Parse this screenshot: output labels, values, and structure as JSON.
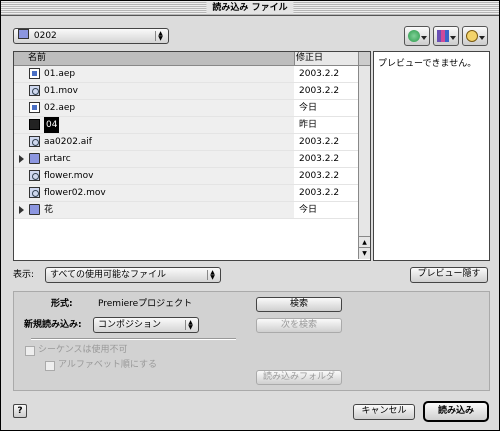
{
  "window": {
    "title": "読み込み ファイル"
  },
  "location": {
    "folder": "0202",
    "folder_icon": "folder-icon"
  },
  "toolbar": [
    {
      "name": "disk-icon",
      "color": "#2b9a4a"
    },
    {
      "name": "favorites-icon",
      "color": "#6a4fb5"
    },
    {
      "name": "recent-clock-icon",
      "color": "#c89b1e"
    }
  ],
  "list": {
    "headers": {
      "name": "名前",
      "modified": "修正日"
    },
    "rows": [
      {
        "name": "01.aep",
        "date": "2003.2.2",
        "icon": "document-icon"
      },
      {
        "name": "01.mov",
        "date": "2003.2.2",
        "icon": "movie-icon"
      },
      {
        "name": "02.aep",
        "date": "今日",
        "icon": "document-icon"
      },
      {
        "name": "04",
        "date": "昨日",
        "icon": "alias-icon",
        "selected": true
      },
      {
        "name": "aa0202.aif",
        "date": "2003.2.2",
        "icon": "audio-icon"
      },
      {
        "name": "artarc",
        "date": "2003.2.2",
        "icon": "folder-icon",
        "folder": true
      },
      {
        "name": "flower.mov",
        "date": "2003.2.2",
        "icon": "movie-icon"
      },
      {
        "name": "flower02.mov",
        "date": "2003.2.2",
        "icon": "movie-icon"
      },
      {
        "name": "花",
        "date": "今日",
        "icon": "folder-icon",
        "folder": true
      }
    ]
  },
  "preview": {
    "message": "プレビューできません。"
  },
  "show": {
    "label": "表示:",
    "value": "すべての使用可能なファイル"
  },
  "preview_button": "プレビュー隠す",
  "options": {
    "format_label": "形式:",
    "format_value": "Premiereプロジェクト",
    "import_as_label": "新規読み込み:",
    "import_as_value": "コンポジション",
    "sequence_label": "シーケンスは使用不可",
    "alpha_order_label": "アルファベット順にする",
    "find_button": "検索",
    "find_next_button": "次を検索",
    "import_folder_button": "読み込みフォルダ"
  },
  "footer": {
    "help": "?",
    "cancel": "キャンセル",
    "import": "読み込み"
  }
}
